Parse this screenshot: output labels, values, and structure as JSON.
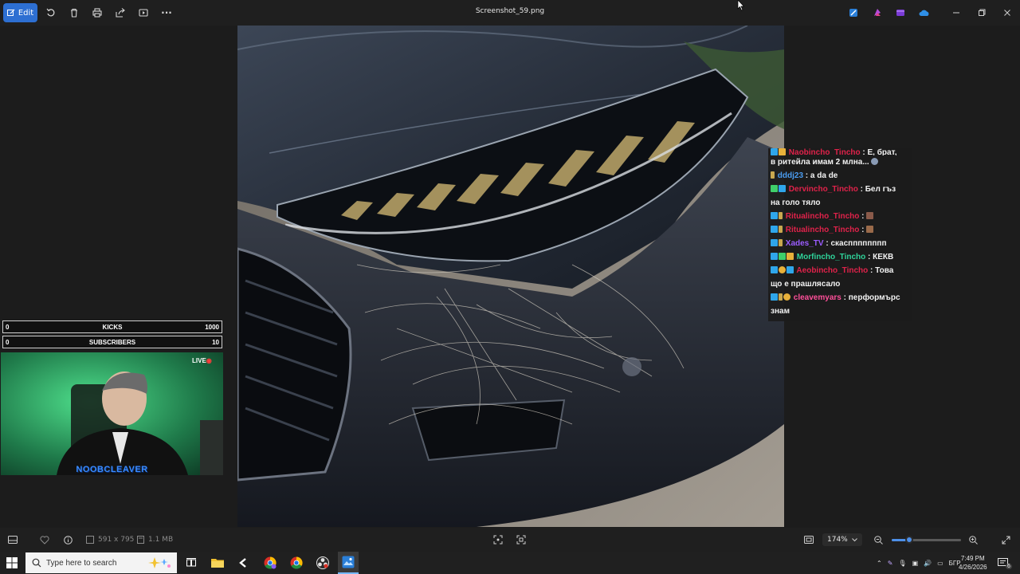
{
  "toolbar": {
    "edit_label": "Edit",
    "title": "Screenshot_59.png",
    "more_label": "···"
  },
  "chat": {
    "lines": [
      {
        "user": "Naobincho_Tincho",
        "msg": " : Е, брат,",
        "user_color": "#e0224a"
      },
      {
        "user": "",
        "msg": "в ритейла имам 2 млна... ",
        "user_color": "#ffffff"
      },
      {
        "user": "dddj23",
        "msg": " : a da de",
        "user_color": "#4a9cf0"
      },
      {
        "user": "Dervincho_Tincho",
        "msg": " : Бел гъз",
        "user_color": "#e0224a"
      },
      {
        "user": "",
        "msg": "на голо тяло",
        "user_color": "#ffffff"
      },
      {
        "user": "Ritualincho_Tincho",
        "msg": " : ",
        "user_color": "#e0224a"
      },
      {
        "user": "Ritualincho_Tincho",
        "msg": " : ",
        "user_color": "#e0224a"
      },
      {
        "user": "Xades_TV",
        "msg": " : скаспппппппп",
        "user_color": "#9b5cff"
      },
      {
        "user": "Morfincho_Tincho",
        "msg": " : КЕКВ",
        "user_color": "#2fd39a"
      },
      {
        "user": "Aeobincho_Tincho",
        "msg": " : Това",
        "user_color": "#e0224a"
      },
      {
        "user": "",
        "msg": "що е прашлясало",
        "user_color": "#ffffff"
      },
      {
        "user": "cleavemyars",
        "msg": " : перформърс",
        "user_color": "#ff4f9a"
      },
      {
        "user": "",
        "msg": "знам",
        "user_color": "#ffffff"
      }
    ]
  },
  "kicks": {
    "left": "0",
    "label": "KICKS",
    "goal": "1000"
  },
  "subs": {
    "left": "0",
    "label": "SUBSCRIBERS",
    "goal": "10"
  },
  "webcam": {
    "live_label": "LIVE",
    "name": "NOOBCLEAVER"
  },
  "statusbar": {
    "dimensions": "591 x 795",
    "filesize": "1.1 MB",
    "zoom": "174%",
    "zoom_level": 0.25
  },
  "taskbar": {
    "search_placeholder": "Type here to search",
    "lang": "БГР",
    "time": "7:49 PM",
    "date": "4/26/2026",
    "notif_count": "6"
  },
  "colors": {
    "accent": "#2d6fd2",
    "bg": "#1c1c1c"
  }
}
